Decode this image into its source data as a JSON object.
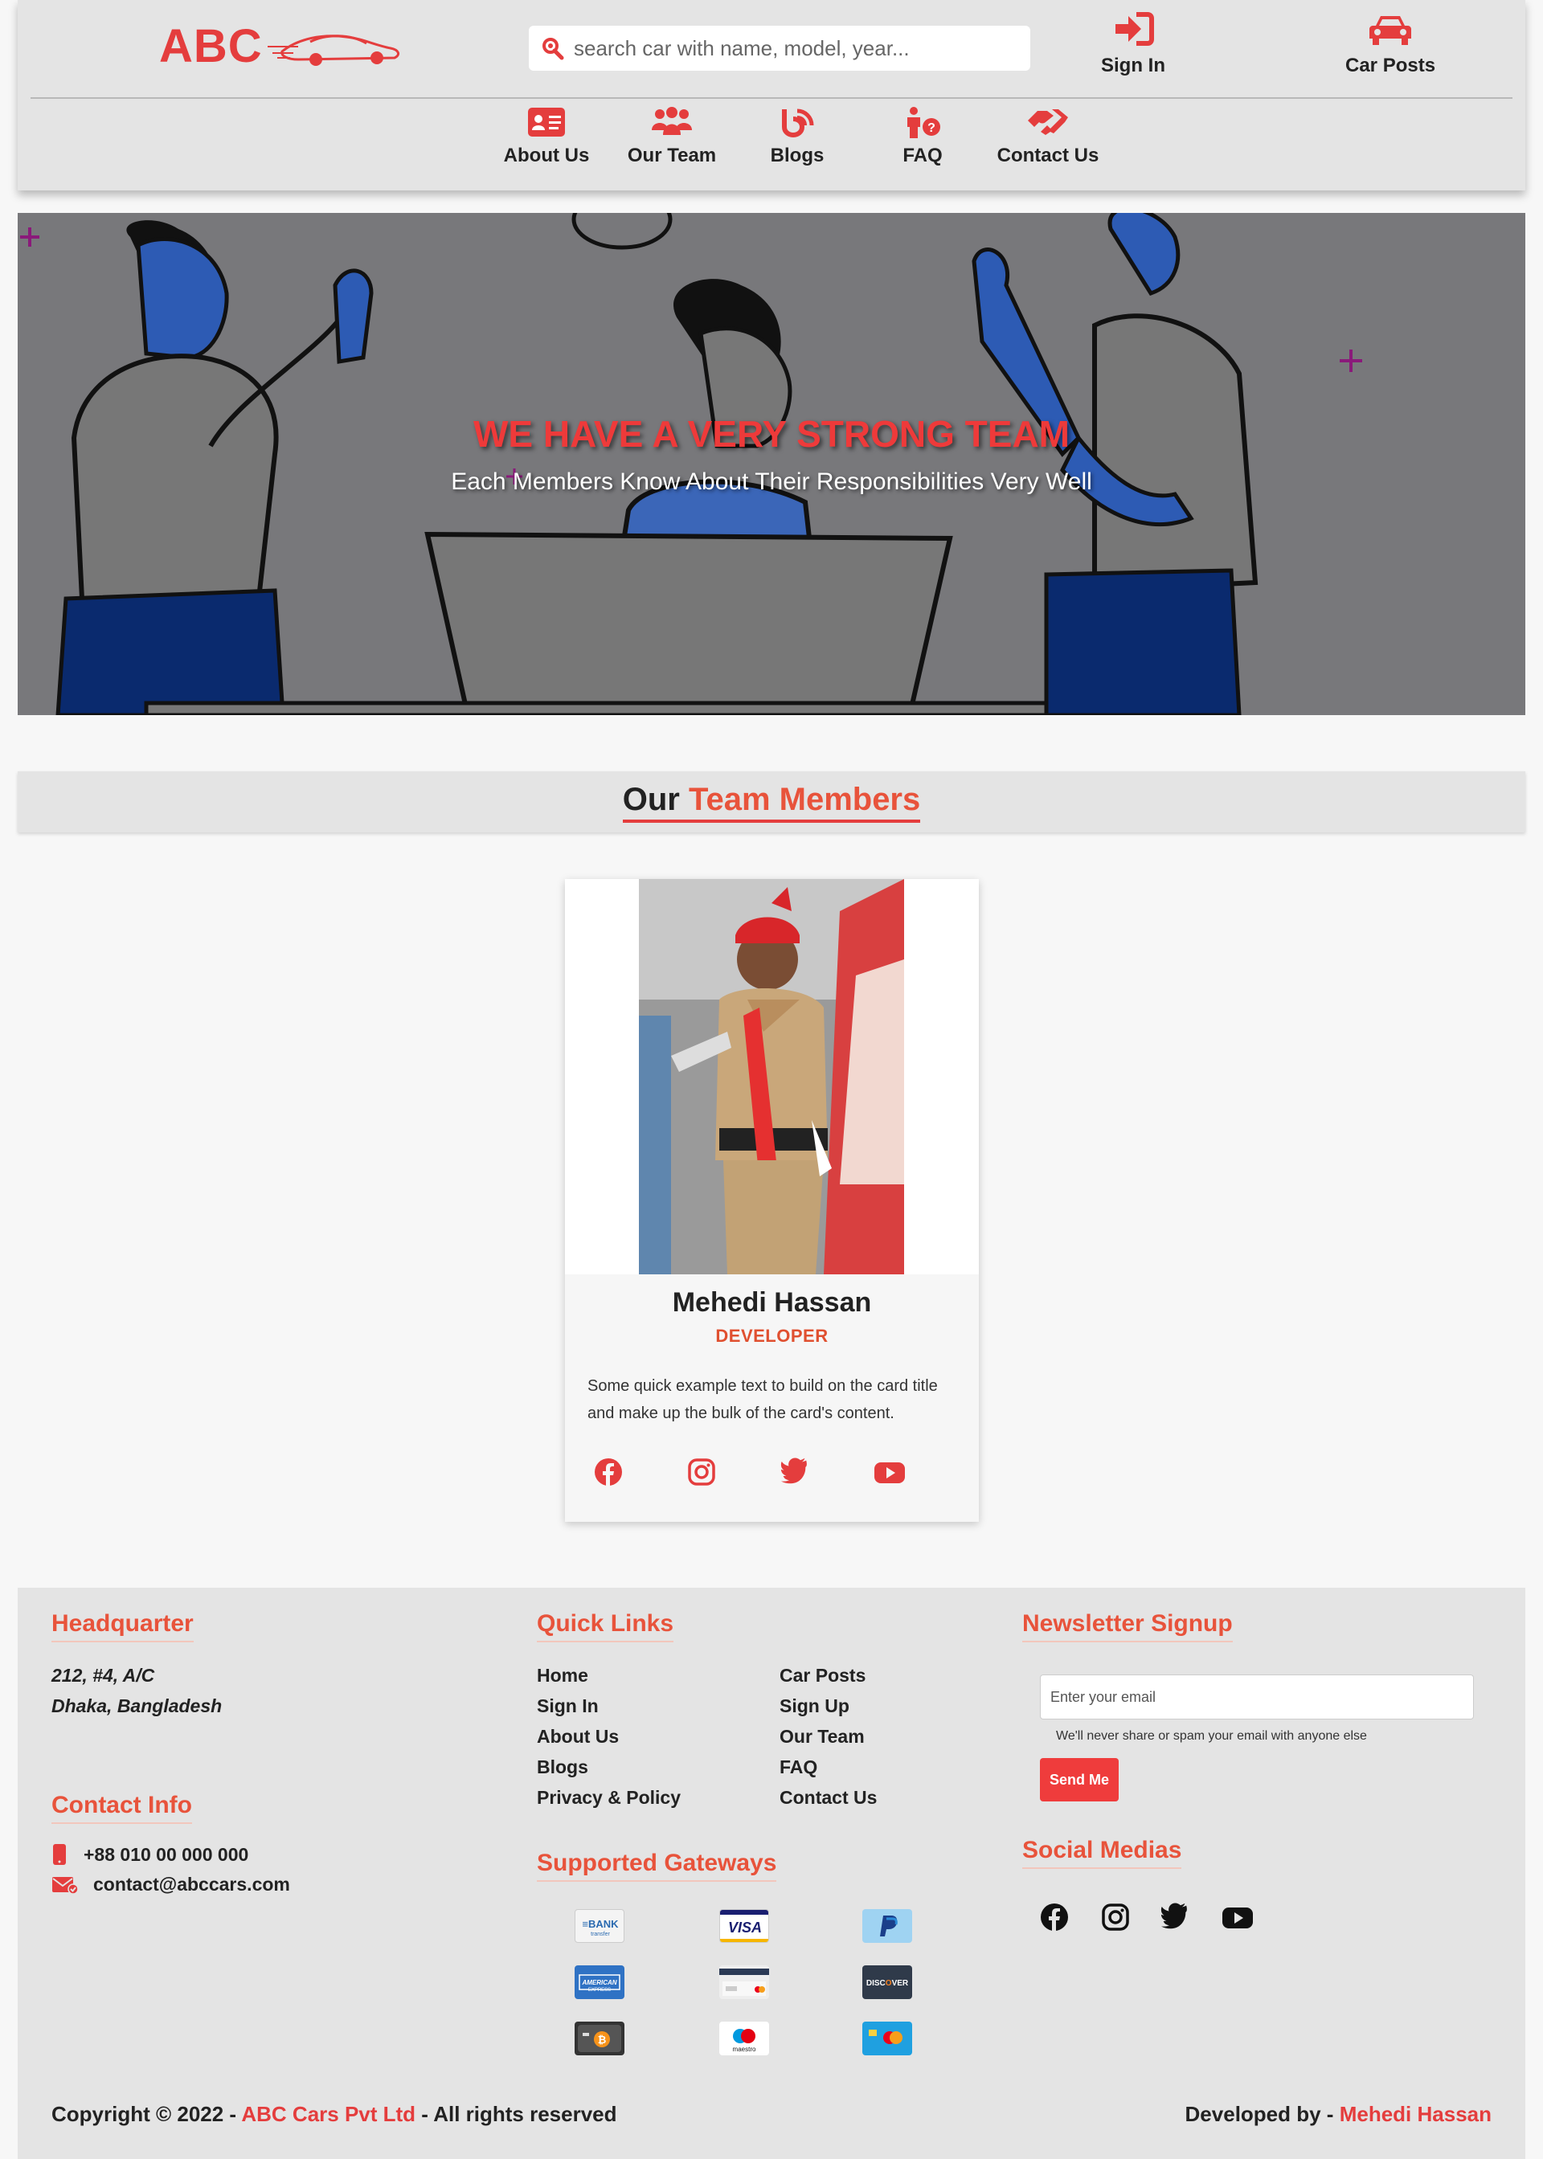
{
  "brand": {
    "name": "ABC",
    "logo_icon": "car-icon"
  },
  "search": {
    "placeholder": "search car with name, model, year..."
  },
  "top_actions": [
    {
      "label": "Sign In",
      "icon": "sign-in-icon"
    },
    {
      "label": "Car Posts",
      "icon": "car-icon"
    }
  ],
  "nav": [
    {
      "label": "About Us",
      "icon": "id-card-icon"
    },
    {
      "label": "Our Team",
      "icon": "team-icon"
    },
    {
      "label": "Blogs",
      "icon": "blog-icon"
    },
    {
      "label": "FAQ",
      "icon": "question-person-icon"
    },
    {
      "label": "Contact Us",
      "icon": "handshake-icon"
    }
  ],
  "hero": {
    "title": "WE HAVE A VERY STRONG TEAM",
    "subtitle": "Each Members Know About Their Responsibilities Very Well"
  },
  "team_section": {
    "heading_part1": "Our",
    "heading_part2": "Team Members"
  },
  "member": {
    "name": "Mehedi Hassan",
    "role": "DEVELOPER",
    "description": "Some quick example text to build on the card title and make up the bulk of the card's content.",
    "socials": [
      "facebook-icon",
      "instagram-icon",
      "twitter-icon",
      "youtube-icon"
    ]
  },
  "footer": {
    "headquarter": {
      "title": "Headquarter",
      "line1": "212, #4, A/C",
      "line2": "Dhaka, Bangladesh"
    },
    "contact": {
      "title": "Contact Info",
      "phone": "+88 010 00 000 000",
      "email": "contact@abccars.com"
    },
    "quick_links": {
      "title": "Quick Links",
      "col1": [
        "Home",
        "Sign In",
        "About Us",
        "Blogs",
        "Privacy & Policy"
      ],
      "col2": [
        "Car Posts",
        "Sign Up",
        "Our Team",
        "FAQ",
        "Contact Us"
      ]
    },
    "gateways": {
      "title": "Supported Gateways",
      "items": [
        "bank-transfer",
        "visa",
        "paypal",
        "american-express",
        "credit-card",
        "discover",
        "bitcoin",
        "maestro",
        "mastercard"
      ]
    },
    "newsletter": {
      "title": "Newsletter Signup",
      "placeholder": "Enter your email",
      "note": "We'll never share or spam your email with anyone else",
      "button": "Send Me"
    },
    "social": {
      "title": "Social Medias",
      "icons": [
        "facebook-icon",
        "instagram-icon",
        "twitter-icon",
        "youtube-icon"
      ]
    },
    "copyright_prefix": "Copyright © 2022 -",
    "copyright_company": "ABC Cars Pvt Ltd",
    "copyright_suffix": "- All rights reserved",
    "developed_prefix": "Developed by -",
    "developer": "Mehedi Hassan"
  },
  "colors": {
    "accent": "#e43d3d",
    "accent_orange": "#e8533b",
    "header_bg": "#e4e4e4"
  }
}
